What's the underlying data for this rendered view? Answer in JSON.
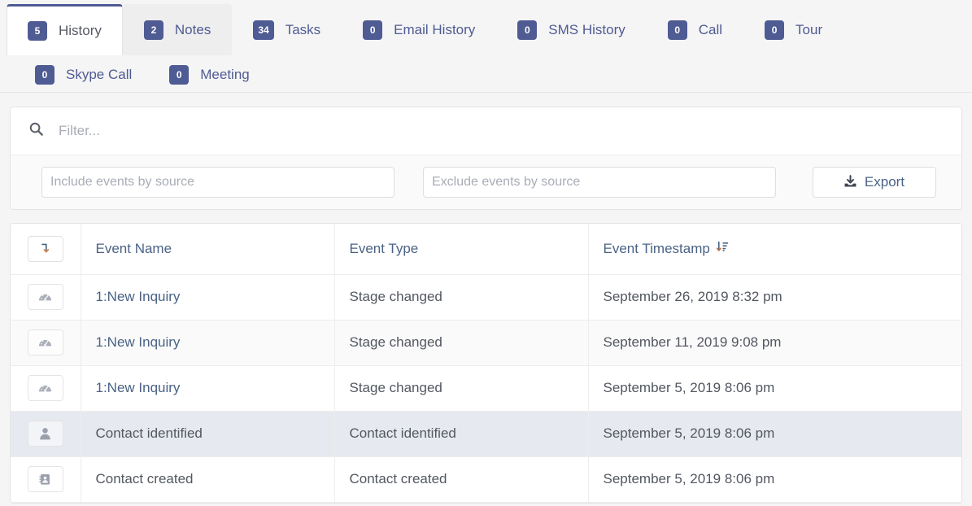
{
  "tabs": {
    "row1": [
      {
        "count": "5",
        "label": "History",
        "state": "active"
      },
      {
        "count": "2",
        "label": "Notes",
        "state": "hover"
      },
      {
        "count": "34",
        "label": "Tasks",
        "state": "normal"
      },
      {
        "count": "0",
        "label": "Email History",
        "state": "normal"
      },
      {
        "count": "0",
        "label": "SMS History",
        "state": "normal"
      },
      {
        "count": "0",
        "label": "Call",
        "state": "normal"
      },
      {
        "count": "0",
        "label": "Tour",
        "state": "normal"
      }
    ],
    "row2": [
      {
        "count": "0",
        "label": "Skype Call",
        "state": "normal"
      },
      {
        "count": "0",
        "label": "Meeting",
        "state": "normal"
      }
    ]
  },
  "filter": {
    "search_placeholder": "Filter...",
    "search_value": "",
    "include_placeholder": "Include events by source",
    "include_value": "",
    "exclude_placeholder": "Exclude events by source",
    "exclude_value": "",
    "export_label": "Export",
    "search_icon": "search-icon",
    "export_icon": "download-icon"
  },
  "table": {
    "headers": {
      "icon": "",
      "event_name": "Event Name",
      "event_type": "Event Type",
      "event_timestamp": "Event Timestamp"
    },
    "header_sort_icon": "sort-amount-desc-icon",
    "header_level_icon": "level-down-icon",
    "rows": [
      {
        "icon": "dashboard-icon",
        "event_name": "1:New Inquiry",
        "name_is_link": true,
        "event_type": "Stage changed",
        "event_timestamp": "September 26, 2019 8:32 pm",
        "row_style": "normal"
      },
      {
        "icon": "dashboard-icon",
        "event_name": "1:New Inquiry",
        "name_is_link": true,
        "event_type": "Stage changed",
        "event_timestamp": "September 11, 2019 9:08 pm",
        "row_style": "striped"
      },
      {
        "icon": "dashboard-icon",
        "event_name": "1:New Inquiry",
        "name_is_link": true,
        "event_type": "Stage changed",
        "event_timestamp": "September 5, 2019 8:06 pm",
        "row_style": "normal"
      },
      {
        "icon": "user-icon",
        "event_name": "Contact identified",
        "name_is_link": false,
        "event_type": "Contact identified",
        "event_timestamp": "September 5, 2019 8:06 pm",
        "row_style": "highlight"
      },
      {
        "icon": "address-book-icon",
        "event_name": "Contact created",
        "name_is_link": false,
        "event_type": "Contact created",
        "event_timestamp": "September 5, 2019 8:06 pm",
        "row_style": "normal"
      }
    ]
  },
  "colors": {
    "accent": "#4f5b93",
    "link": "#4a6285",
    "text": "#525760",
    "page_bg": "#f5f5f5",
    "row_highlight": "#e7e9f0"
  }
}
